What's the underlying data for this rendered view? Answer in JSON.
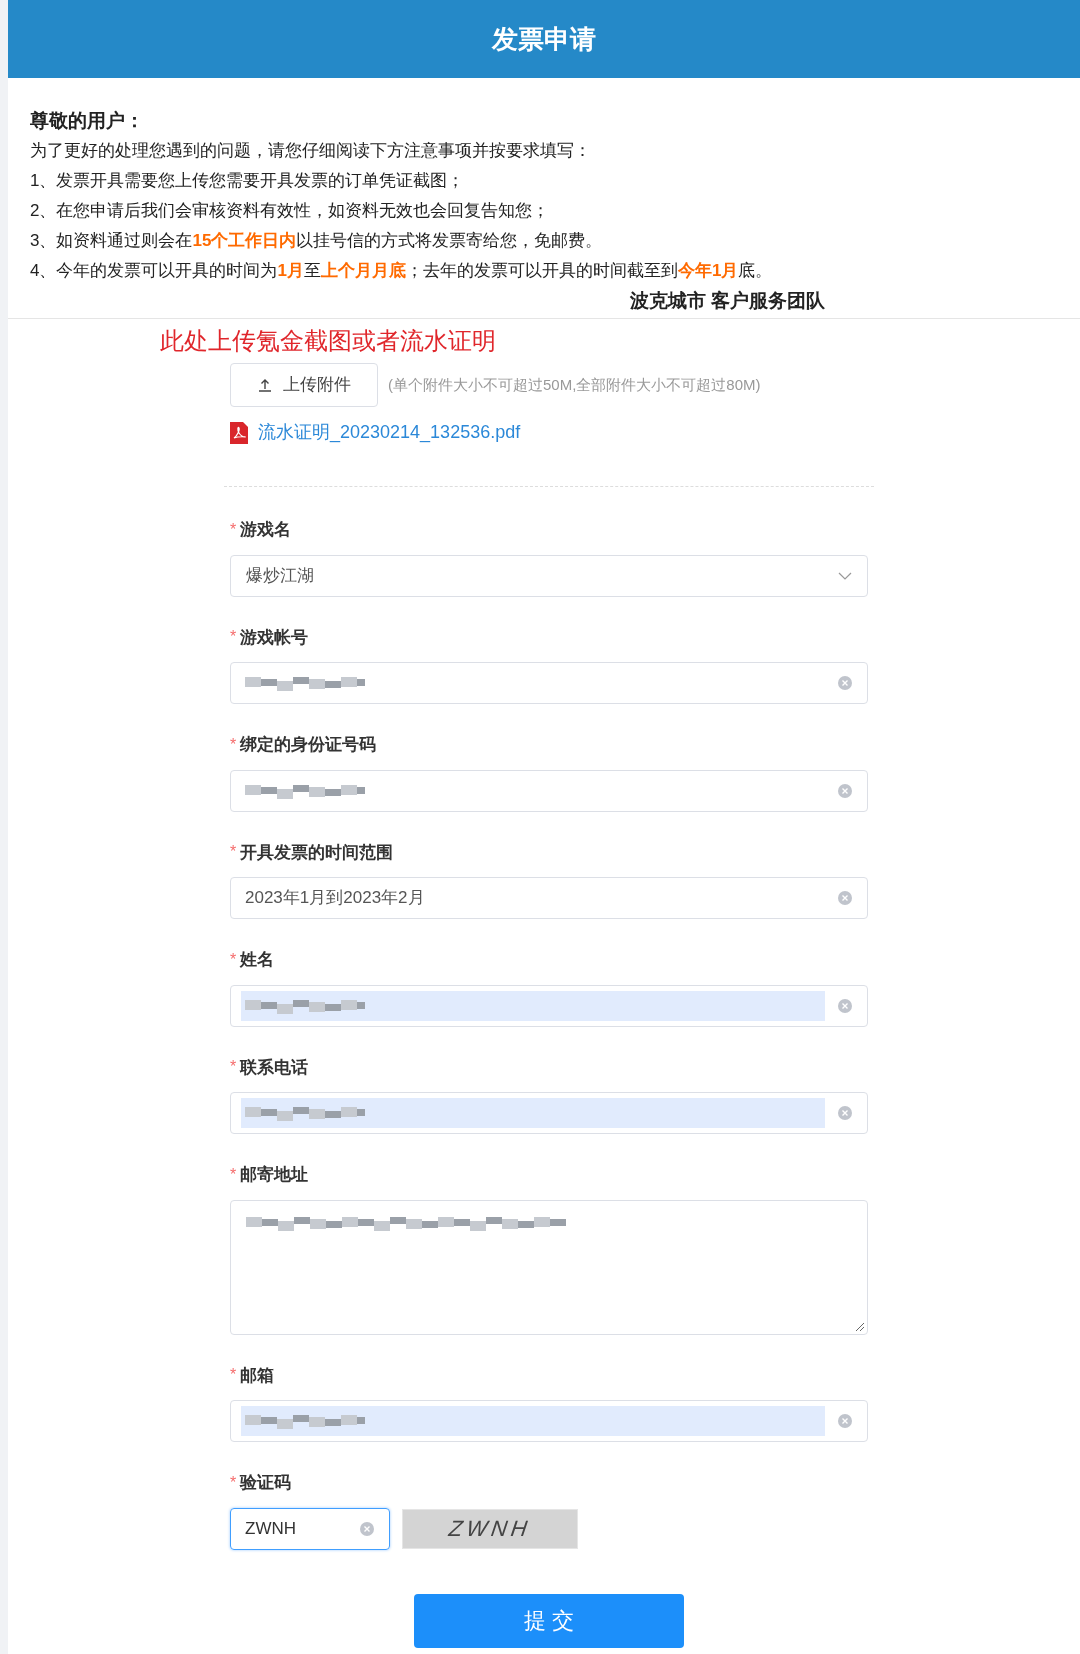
{
  "header": {
    "title": "发票申请"
  },
  "notice": {
    "greeting": "尊敬的用户：",
    "intro": "为了更好的处理您遇到的问题，请您仔细阅读下方注意事项并按要求填写：",
    "items": [
      "1、发票开具需要您上传您需要开具发票的订单凭证截图；",
      "2、在您申请后我们会审核资料有效性，如资料无效也会回复告知您；",
      "3、如资料通过则会在**15个工作日内**以挂号信的方式将发票寄给您，免邮费。",
      "4、今年的发票可以开具的时间为**1月**至**上个月月底**；去年的发票可以开具的时间截至到**今年1月**底。"
    ],
    "signature": "波克城市 客户服务团队"
  },
  "upload": {
    "note": "此处上传氪金截图或者流水证明",
    "button": "上传附件",
    "hint": "(单个附件大小不可超过50M,全部附件大小不可超过80M)",
    "files": [
      "流水证明_20230214_132536.pdf"
    ]
  },
  "fields": [
    {
      "kind": "select",
      "label": "游戏名",
      "mark": "*",
      "value": "爆炒江湖"
    },
    {
      "kind": "text",
      "label": "游戏帐号",
      "mark": "*",
      "hidden": true,
      "autofilled": false
    },
    {
      "kind": "text",
      "label": "绑定的身份证号码",
      "mark": "*",
      "hidden": true,
      "autofilled": false
    },
    {
      "kind": "text",
      "label": "开具发票的时间范围",
      "mark": "*",
      "value": "2023年1月到2023年2月",
      "hidden": false,
      "autofilled": false
    },
    {
      "kind": "text",
      "label": "姓名",
      "mark": "*",
      "hidden": true,
      "autofilled": true
    },
    {
      "kind": "text",
      "label": "联系电话",
      "mark": "*",
      "hidden": true,
      "autofilled": true
    },
    {
      "kind": "textarea",
      "label": "邮寄地址",
      "mark": "*",
      "hidden": true,
      "autofilled": false
    },
    {
      "kind": "text",
      "label": "邮箱",
      "mark": "*",
      "hidden": true,
      "autofilled": true
    }
  ],
  "captcha": {
    "label": "验证码",
    "mark": "*",
    "value": "ZWNH",
    "code": "ZWNH"
  },
  "submit": "提 交"
}
